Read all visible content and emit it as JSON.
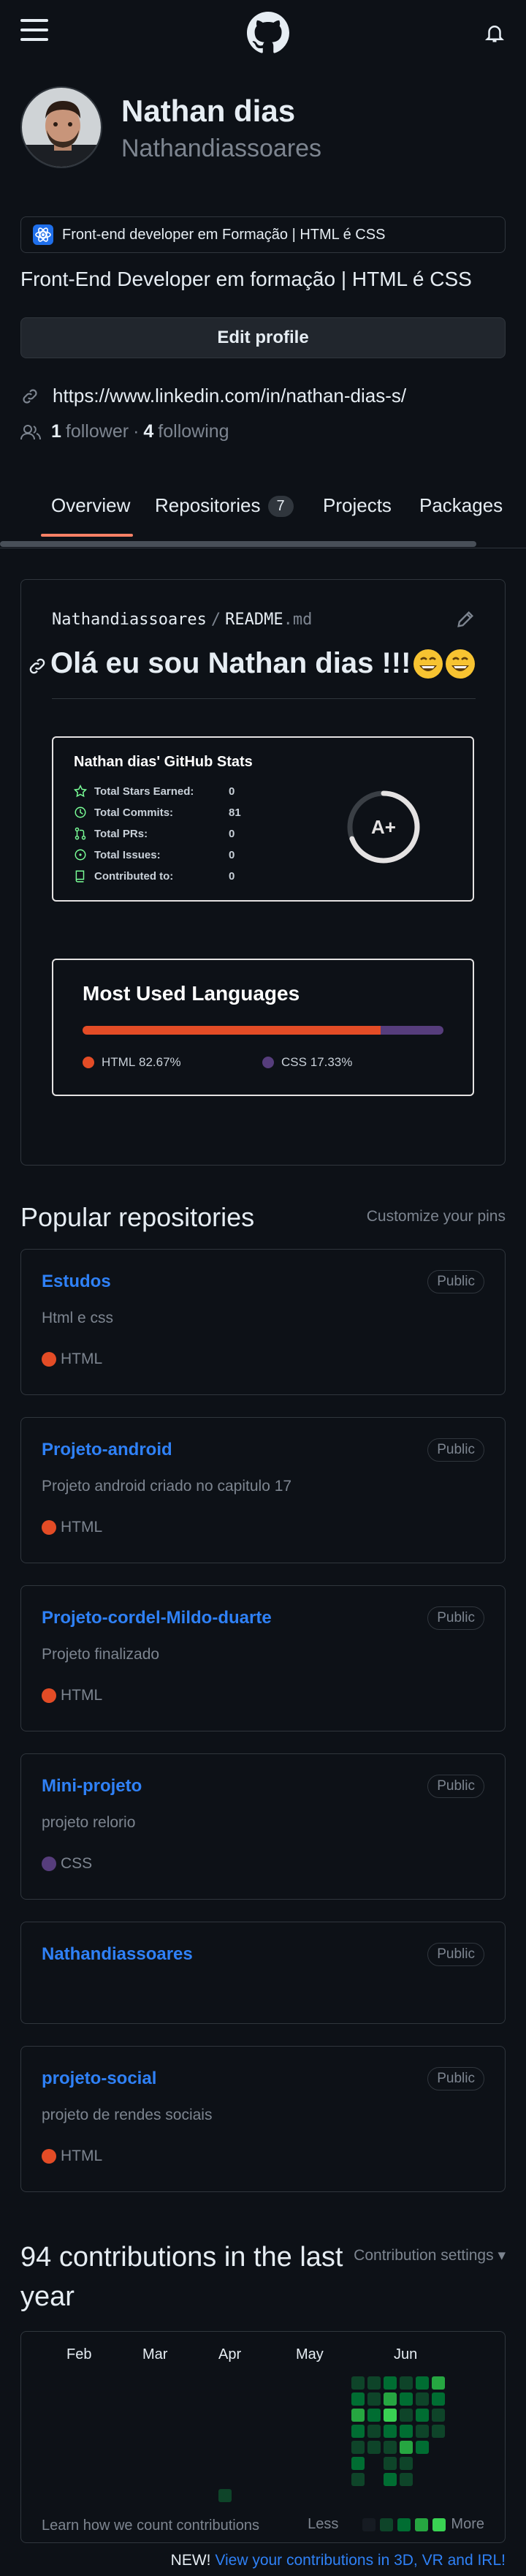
{
  "header": {
    "logo": "github-logo-icon",
    "menu_icon": "hamburger-icon",
    "notifications_icon": "bell-icon"
  },
  "profile": {
    "name": "Nathan dias",
    "username": "Nathandiassoares",
    "status": "Front-end developer em Formação | HTML é CSS",
    "bio": "Front-End Developer em formação | HTML é CSS",
    "edit_label": "Edit profile",
    "link": "https://www.linkedin.com/in/nathan-dias-s/",
    "followers_count": "1",
    "followers_label": "follower",
    "separator": "·",
    "following_count": "4",
    "following_label": "following"
  },
  "tabs": [
    {
      "label": "Overview",
      "active": true
    },
    {
      "label": "Repositories",
      "count": "7"
    },
    {
      "label": "Projects"
    },
    {
      "label": "Packages"
    }
  ],
  "readme": {
    "owner": "Nathandiassoares",
    "slash": "/",
    "file": "README",
    "ext": ".md",
    "heading": "Olá eu sou Nathan dias !!!",
    "stats": {
      "title": "Nathan dias' GitHub Stats",
      "rows": [
        {
          "label": "Total Stars Earned:",
          "value": "0",
          "icon": "star-icon"
        },
        {
          "label": "Total Commits:",
          "value": "81",
          "icon": "history-icon"
        },
        {
          "label": "Total PRs:",
          "value": "0",
          "icon": "pull-request-icon"
        },
        {
          "label": "Total Issues:",
          "value": "0",
          "icon": "issue-icon"
        },
        {
          "label": "Contributed to:",
          "value": "0",
          "icon": "repo-icon"
        }
      ],
      "grade": "A+"
    },
    "languages": {
      "title": "Most Used Languages",
      "items": [
        {
          "name": "HTML",
          "percent": "82.67%",
          "value": 82.67,
          "color": "#e34c26"
        },
        {
          "name": "CSS",
          "percent": "17.33%",
          "value": 17.33,
          "color": "#563d7c"
        }
      ]
    }
  },
  "popular": {
    "title": "Popular repositories",
    "customize": "Customize your pins",
    "repos": [
      {
        "name": "Estudos",
        "badge": "Public",
        "desc": "Html e css",
        "lang": "HTML",
        "lang_color": "#e34c26"
      },
      {
        "name": "Projeto-android",
        "badge": "Public",
        "desc": "Projeto android criado no capitulo 17",
        "lang": "HTML",
        "lang_color": "#e34c26"
      },
      {
        "name": "Projeto-cordel-Mildo-duarte",
        "badge": "Public",
        "desc": "Projeto finalizado",
        "lang": "HTML",
        "lang_color": "#e34c26"
      },
      {
        "name": "Mini-projeto",
        "badge": "Public",
        "desc": "projeto relorio",
        "lang": "CSS",
        "lang_color": "#563d7c"
      },
      {
        "name": "Nathandiassoares",
        "badge": "Public",
        "desc": "",
        "lang": "",
        "lang_color": ""
      },
      {
        "name": "projeto-social",
        "badge": "Public",
        "desc": "projeto de rendes sociais",
        "lang": "HTML",
        "lang_color": "#e34c26"
      }
    ]
  },
  "contributions": {
    "title": "94 contributions in the last year",
    "settings": "Contribution settings ▾",
    "months": [
      "Feb",
      "Mar",
      "Apr",
      "May",
      "Jun"
    ],
    "footer_link": "Learn how we count contributions",
    "less": "Less",
    "more": "More",
    "new_label": "NEW!",
    "new_link": "View your contributions in 3D, VR and IRL!",
    "legend_colors": [
      "#161b22",
      "#0e4429",
      "#006d32",
      "#26a641",
      "#39d353"
    ]
  }
}
